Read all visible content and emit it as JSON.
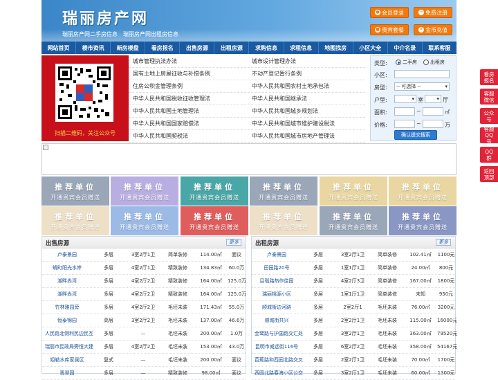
{
  "header": {
    "logo": "瑞丽房产网",
    "subtitle": "瑞丽房产网二手房信息　瑞丽房产网出租房信息",
    "buttons": [
      {
        "label": "会员登录",
        "icon": "user-icon"
      },
      {
        "label": "免费注册",
        "icon": "person-add-icon"
      },
      {
        "label": "贵宾套餐",
        "icon": "gift-icon"
      },
      {
        "label": "金币充值",
        "icon": "coin-icon"
      }
    ]
  },
  "nav": [
    "网站首页",
    "楼市资讯",
    "新房楼盘",
    "看房报名",
    "出售房源",
    "出租房源",
    "求购信息",
    "求租信息",
    "地图找房",
    "小区大全",
    "中介名录",
    "联系客服"
  ],
  "qr": {
    "caption": "扫描二维码，关注公众号"
  },
  "laws": {
    "left": [
      "城市管理执法办法",
      "国有土地上房屋征收与补偿条例",
      "住房公积金管理条例",
      "中华人民共和国税收征收管理法",
      "中华人民共和国土地管理法",
      "中华人民共和国国家赔偿法",
      "中华人民共和国契税法"
    ],
    "right": [
      "城市设计管理办法",
      "不动产登记暂行条例",
      "中华人民共和国农村土地承包法",
      "中华人民共和国继承法",
      "中华人民共和国城乡规划法",
      "中华人民共和国城市维护建设税法",
      "中华人民共和国城市房地产管理法"
    ]
  },
  "search": {
    "type_label": "类型:",
    "opt1": "二手房",
    "opt2": "出租房",
    "community_label": "小区:",
    "room_label": "房型:",
    "room_value": "-- 可选择 --",
    "layout_label": "户型:",
    "shi": "室",
    "ting": "厅",
    "area_label": "面积:",
    "tilde": "~",
    "area_unit": "㎡",
    "price_label": "价格:",
    "price_unit": "万",
    "submit": "确认提交搜索"
  },
  "ads": {
    "title": "推荐单位",
    "subtitle": "开通贵宾会员赠送",
    "colors": [
      "#9aa7b8",
      "#b9aee2",
      "#4aa7a8",
      "#9aa7b8",
      "#e9d6a0",
      "#e9d6a0",
      "#ede0c6",
      "#9bbbe6",
      "#e05d5d",
      "#ede0c6",
      "#9aa7b8",
      "#8a96c4"
    ]
  },
  "sale": {
    "title": "出售房源",
    "more": "更多",
    "rows": [
      [
        "卢泰景园",
        "多层",
        "3室2厅1卫",
        "简单装修",
        "114.00㎡",
        "面议"
      ],
      [
        "蜻町阳光水岸",
        "多层",
        "4室2厅1卫",
        "精致装修",
        "134.83㎡",
        "60.0万"
      ],
      [
        "湖畔尚湾",
        "多层",
        "4室2厅2卫",
        "精致装修",
        "164.00㎡",
        "125.0万"
      ],
      [
        "湖畔尚湾",
        "多层",
        "4室2厅2卫",
        "精致装修",
        "164.00㎡",
        "125.0万"
      ],
      [
        "竹林雅园旁",
        "多层",
        "4室2厅2卫",
        "毛坯未装",
        "171.43㎡",
        "55.0万"
      ],
      [
        "恒泰锦园",
        "高层",
        "3室2厅2卫",
        "毛坯未装",
        "137.00㎡",
        "46.6万"
      ],
      [
        "人民路北侧利民边民互",
        "多层",
        "—",
        "毛坯未装",
        "200.00㎡",
        "1.0万"
      ],
      [
        "瑞丽市民政局旁恒大建",
        "多层",
        "4室2厅2卫",
        "毛坯未装",
        "153.00㎡",
        "43.0万"
      ],
      [
        "姐勒水库家属区",
        "复式",
        "—",
        "毛坯未装",
        "200.00㎡",
        "面议"
      ],
      [
        "翡翠园",
        "多层",
        "—",
        "精致装修",
        "98.00㎡",
        "面议"
      ]
    ]
  },
  "rent": {
    "title": "出租房源",
    "more": "更多",
    "rows": [
      [
        "卢泰景园",
        "多层",
        "3室2厅1卫",
        "简单装修",
        "102.41㎡",
        "1100元"
      ],
      [
        "田园路20号",
        "多层",
        "1室1厅1卫",
        "简单装修",
        "24.00㎡",
        "800元"
      ],
      [
        "目瑙路热作佳园",
        "多层",
        "4室2厅3卫",
        "简单装修",
        "167.00㎡",
        "1800元"
      ],
      [
        "瑞丽桃源小区",
        "多层",
        "1室1厅1卫",
        "简单装修",
        "未知",
        "950元"
      ],
      [
        "顺城街边河路",
        "多层",
        "2室2厅1",
        "毛坯未装",
        "76.00㎡",
        "3200元"
      ],
      [
        "顺城街共兴",
        "多层",
        "2室2厅1卫",
        "毛坯未装",
        "115.00㎡",
        "16000元"
      ],
      [
        "金鹭路与护国路交汇处",
        "多层",
        "3室2厅1卫",
        "毛坯未装",
        "363.00㎡",
        "79520元"
      ],
      [
        "昆明市威远街116号",
        "多层",
        "6室2厅2卫",
        "毛坯未装",
        "358.00㎡",
        "54167元"
      ],
      [
        "芭蕉路和西园北路交叉",
        "多层",
        "2室2厅1卫",
        "毛坯未装",
        "70.00㎡",
        "1700元"
      ],
      [
        "西园北路春海小区公交",
        "多层",
        "3室2厅1卫",
        "毛坯未装",
        "60.00㎡",
        "1300元"
      ]
    ]
  },
  "side": [
    "看房报名",
    "客服微信",
    "公众号",
    "客服QQ号",
    "QQ群",
    "返回顶部"
  ]
}
